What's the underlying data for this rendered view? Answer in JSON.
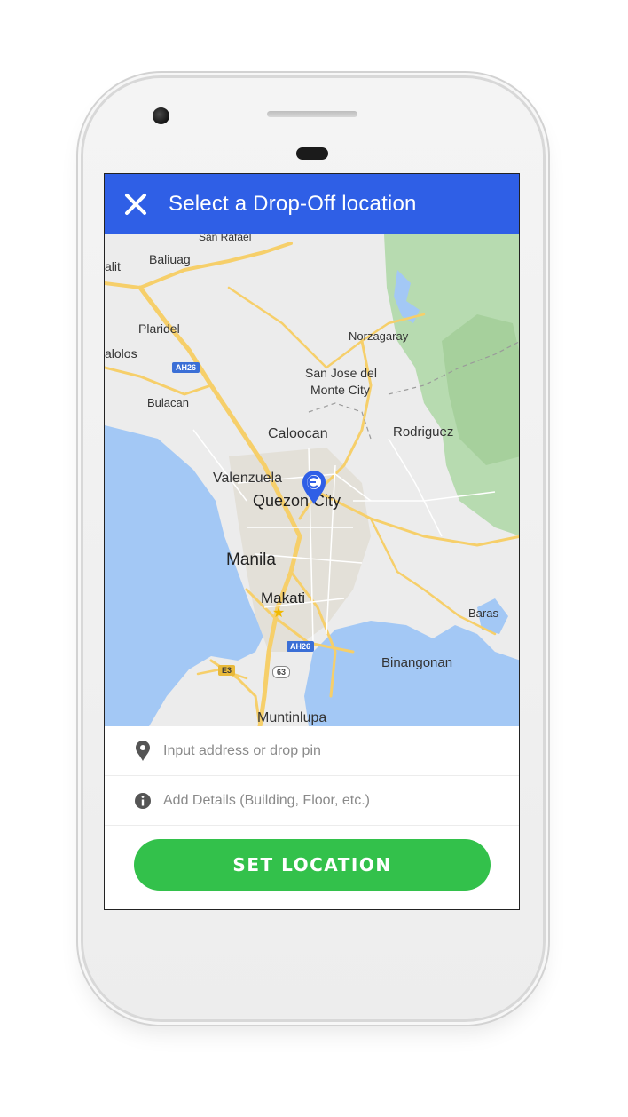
{
  "appbar": {
    "title": "Select a Drop-Off location",
    "close_icon": "close-icon"
  },
  "map": {
    "labels": {
      "san_rafael": "San Rafael",
      "baliuag": "Baliuag",
      "malit": "alit",
      "plaridel": "Plaridel",
      "malolos": "alolos",
      "norzagaray": "Norzagaray",
      "san_jose_1": "San Jose del",
      "san_jose_2": "Monte City",
      "bulacan": "Bulacan",
      "caloocan": "Caloocan",
      "rodriguez": "Rodriguez",
      "valenzuela": "Valenzuela",
      "quezon_city": "Quezon City",
      "manila": "Manila",
      "makati": "Makati",
      "baras": "Baras",
      "binangonan": "Binangonan",
      "muntinlupa": "Muntinlupa"
    },
    "shields": {
      "ah26_north": "AH26",
      "ah26_south": "AH26",
      "e3": "E3",
      "r63": "63"
    },
    "pin_icon": "map-pin-icon"
  },
  "form": {
    "address_placeholder": "Input address or drop pin",
    "address_icon": "location-pin-icon",
    "details_placeholder": "Add Details (Building, Floor, etc.)",
    "details_icon": "info-icon",
    "submit_label": "SET LOCATION"
  },
  "colors": {
    "appbar": "#2f5fe6",
    "button": "#33c14b",
    "water": "#a3c8f5",
    "park": "#a9d3a3",
    "road": "#f6cf6a"
  }
}
